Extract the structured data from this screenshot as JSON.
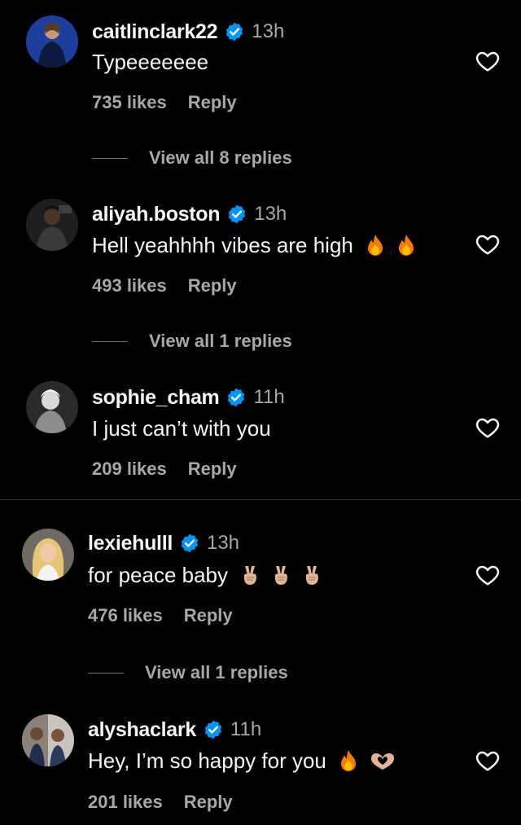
{
  "comments": [
    {
      "username": "caitlinclark22",
      "time": "13h",
      "text": "Typeeeeeee",
      "likes": "735 likes",
      "reply_label": "Reply",
      "view_replies": "View all 8 replies"
    },
    {
      "username": "aliyah.boston",
      "time": "13h",
      "text": "Hell yeahhhh vibes are high",
      "emojis": [
        "fire",
        "fire"
      ],
      "likes": "493 likes",
      "reply_label": "Reply",
      "view_replies": "View all 1 replies"
    },
    {
      "username": "sophie_cham",
      "time": "11h",
      "text": "I just can’t with you",
      "likes": "209 likes",
      "reply_label": "Reply"
    },
    {
      "username": "lexiehulll",
      "time": "13h",
      "text": "for peace baby",
      "emojis": [
        "victory-hand",
        "victory-hand",
        "victory-hand"
      ],
      "likes": "476 likes",
      "reply_label": "Reply",
      "view_replies": "View all 1 replies"
    },
    {
      "username": "alyshaclark",
      "time": "11h",
      "text": "Hey, I’m so happy for you",
      "emojis": [
        "fire",
        "heart-hands"
      ],
      "likes": "201 likes",
      "reply_label": "Reply"
    }
  ],
  "colors": {
    "background": "#000000",
    "primary_text": "#f5f5f5",
    "secondary_text": "#a8a8a8",
    "verified_badge": "#0095f6"
  },
  "icons": [
    "verified-badge-icon",
    "heart-outline-icon",
    "fire-emoji-icon",
    "victory-hand-emoji-icon",
    "heart-hands-emoji-icon"
  ]
}
